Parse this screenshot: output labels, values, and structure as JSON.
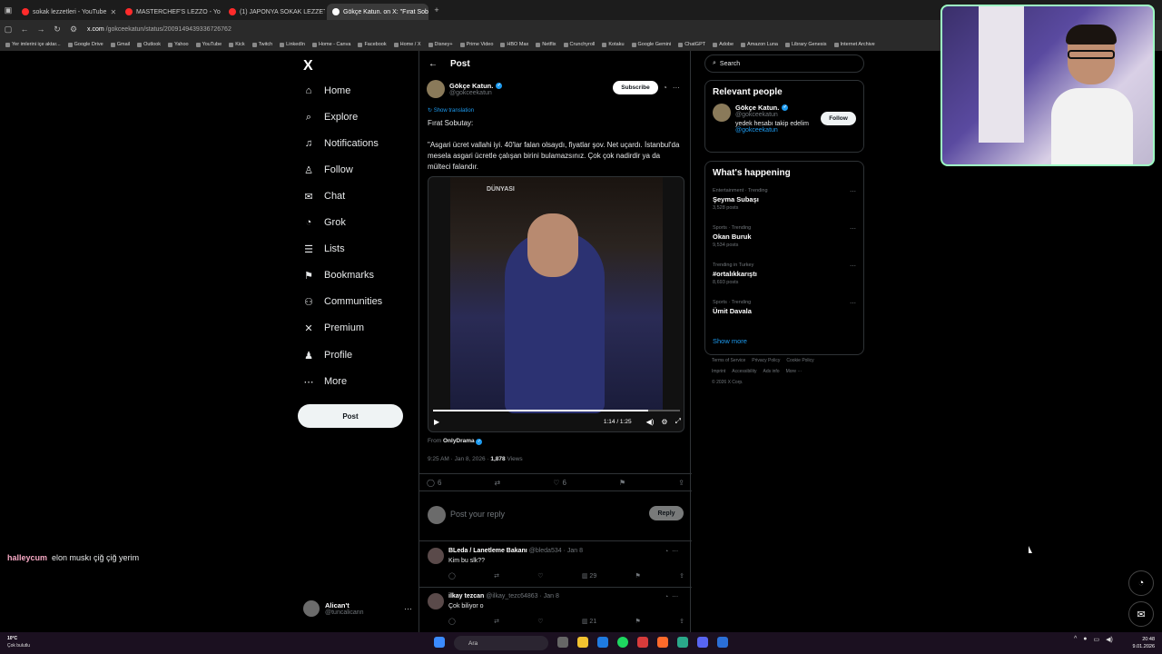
{
  "tabs": [
    {
      "title": "sokak lezzetleri - YouTube",
      "color": "#ff2b2b",
      "active": false
    },
    {
      "title": "MASTERCHEF'S LEZZO - Yo",
      "color": "#ff2b2b",
      "active": false
    },
    {
      "title": "(1) JAPONYA SOKAK LEZZETLE",
      "color": "#ff2b2b",
      "active": false
    },
    {
      "title": "Gökçe Katun. on X: \"Fırat Sobut",
      "color": "#ffffff",
      "active": true
    }
  ],
  "address": {
    "host": "x.com",
    "path": "/gokceekatun/status/2009149439336726762"
  },
  "bookmarks": [
    "Yer imlerini içe aktar...",
    "Google Drive",
    "Gmail",
    "Outlook",
    "Yahoo",
    "YouTube",
    "Kick",
    "Twitch",
    "LinkedIn",
    "Home - Canva",
    "Facebook",
    "Home / X",
    "Disney+",
    "Prime Video",
    "HBO Max",
    "Netflix",
    "Crunchyroll",
    "Kotaku",
    "Google Gemini",
    "ChatGPT",
    "Adobe",
    "Amazon Luna",
    "Library Genesis",
    "Internet Archive"
  ],
  "nav": {
    "logo": "X",
    "items": [
      {
        "label": "Home",
        "icon": "home-icon",
        "glyph": "⌂"
      },
      {
        "label": "Explore",
        "icon": "search-icon",
        "glyph": "⌕"
      },
      {
        "label": "Notifications",
        "icon": "bell-icon",
        "glyph": "♫"
      },
      {
        "label": "Follow",
        "icon": "follow-icon",
        "glyph": "♙"
      },
      {
        "label": "Chat",
        "icon": "mail-icon",
        "glyph": "✉"
      },
      {
        "label": "Grok",
        "icon": "grok-icon",
        "glyph": "◔"
      },
      {
        "label": "Lists",
        "icon": "lists-icon",
        "glyph": "☰"
      },
      {
        "label": "Bookmarks",
        "icon": "bookmark-icon",
        "glyph": "⚑"
      },
      {
        "label": "Communities",
        "icon": "communities-icon",
        "glyph": "⚇"
      },
      {
        "label": "Premium",
        "icon": "x-icon",
        "glyph": "✕"
      },
      {
        "label": "Profile",
        "icon": "profile-icon",
        "glyph": "♟"
      },
      {
        "label": "More",
        "icon": "more-icon",
        "glyph": "⋯"
      }
    ],
    "post_label": "Post",
    "account": {
      "name": "Alican't",
      "handle": "@tuncalicann"
    }
  },
  "post": {
    "header": "Post",
    "author": {
      "name": "Gökçe Katun.",
      "handle": "@gokceekatun"
    },
    "subscribe_label": "Subscribe",
    "show_translation": "Show translation",
    "text_line1": "Fırat Sobutay:",
    "text_line2": "\"Asgari ücret vallahi iyi. 40'lar falan olsaydı, fiyatlar şov. Net uçardı. İstanbul'da mesela asgari ücretle çalışan birini bulamazsınız. Çok çok nadirdir ya da mülteci falandır.",
    "video": {
      "sign": "DÜNYASI",
      "time": "1:14 / 1:25",
      "progress": 0.87
    },
    "from_label": "From",
    "from_source": "OnlyDrama",
    "time": "9:25 AM · Jan 8, 2026 · ",
    "views": "1,878",
    "views_label": " Views",
    "replies": "6",
    "likes": "6",
    "reply_placeholder": "Post your reply",
    "reply_button": "Reply"
  },
  "replies": [
    {
      "name": "BLeda / Lanetleme Bakanı",
      "meta": "@bleda534 · Jan 8",
      "text": "Kim bu slk??",
      "views": "29"
    },
    {
      "name": "ilkay tezcan",
      "meta": "@ilkay_tezc64863 · Jan 8",
      "text": "Çok biliyor o",
      "views": "21"
    }
  ],
  "sidebar": {
    "search_placeholder": "Search",
    "relevant_title": "Relevant people",
    "person": {
      "name": "Gökçe Katun.",
      "handle": "@gokceekatun",
      "bio": "yedek hesabı takip edelim",
      "bio_link": "@gokceekatun",
      "follow": "Follow"
    },
    "happening_title": "What's happening",
    "trends": [
      {
        "context": "Entertainment · Trending",
        "title": "Şeyma Subaşı",
        "posts": "3,528 posts"
      },
      {
        "context": "Sports · Trending",
        "title": "Okan Buruk",
        "posts": "9,534 posts"
      },
      {
        "context": "Trending in Turkey",
        "title": "#ortalıkkarıştı",
        "posts": "8,693 posts"
      },
      {
        "context": "Sports · Trending",
        "title": "Ümit Davala",
        "posts": ""
      }
    ],
    "show_more": "Show more",
    "footer": [
      "Terms of Service",
      "Privacy Policy",
      "Cookie Policy",
      "Imprint",
      "Accessibility",
      "Ads info",
      "More ···",
      "© 2026 X Corp."
    ]
  },
  "chat_overlay": {
    "user": "halleycum",
    "message": "elon muskı çiğ çiğ yerim"
  },
  "taskbar": {
    "temp": "10°C",
    "weather": "Çok bulutlu",
    "search": "Ara",
    "time": "20:48",
    "date": "9.01.2026"
  }
}
